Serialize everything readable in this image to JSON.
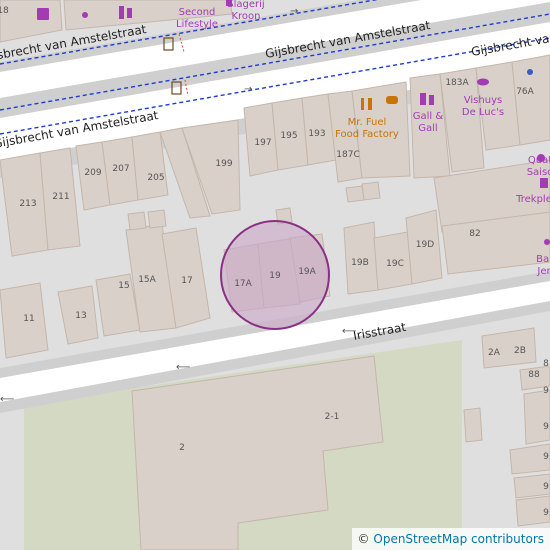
{
  "colors": {
    "background": "#e0dfdf",
    "building": "#d9d0c9",
    "building_stroke": "#c4b6ab",
    "road": "#ffffff",
    "road_casing": "#cfcfcf",
    "bike_route": "#1f3bd1",
    "landuse": "#d3d9c3",
    "poi_label": "#a33bb5",
    "poi_orange": "#c77400",
    "highlight_fill": "#c9a6c8",
    "highlight_stroke": "#8b2f86",
    "housenumber": "#555555",
    "street_label": "#222222"
  },
  "streets": [
    {
      "name": "Gijsbrecht van Amstelstraat"
    },
    {
      "name": "Gijsbrecht van Amstelstraat"
    },
    {
      "name": "Gijsbrecht van Amstelstraat"
    },
    {
      "name": "Gijsbrecht van Amstelstraat"
    },
    {
      "name": "Irisstraat"
    }
  ],
  "pois": [
    {
      "name": "Second Lifestyle",
      "lines": [
        "Second",
        "Lifestyle"
      ],
      "icon": "gift-shop-icon"
    },
    {
      "name": "Slagerij Kroon",
      "lines": [
        "Slagerij",
        "Kroon"
      ],
      "icon": "butcher-icon"
    },
    {
      "name": "Mr. Fuel Food Factory",
      "lines": [
        "Mr. Fuel",
        "Food Factory"
      ],
      "icon": "restaurant-icon"
    },
    {
      "name": "Gall & Gall",
      "lines": [
        "Gall &",
        "Gall"
      ],
      "icon": "liquor-store-icon"
    },
    {
      "name": "Vishuys De Luc's",
      "lines": [
        "Vishuys",
        "De Luc's"
      ],
      "icon": "fish-shop-icon"
    },
    {
      "name": "Quatre Saisons",
      "lines": [
        "Quat",
        "Saiso"
      ],
      "icon": "bakery-icon"
    },
    {
      "name": "Trekpleister",
      "lines": [
        "Trekple"
      ],
      "icon": "bicycle-shop-icon"
    },
    {
      "name": "Bakker Jerry",
      "lines": [
        "Bal",
        "Jer"
      ],
      "icon": "bakery-icon"
    }
  ],
  "housenumbers": [
    "18",
    "213",
    "211",
    "209",
    "207",
    "205",
    "199",
    "197",
    "195",
    "193",
    "187C",
    "183A",
    "76A",
    "11",
    "13",
    "15",
    "15A",
    "17",
    "17A",
    "19",
    "19A",
    "19B",
    "19C",
    "19D",
    "82",
    "2A",
    "2B",
    "88",
    "9",
    "2-1",
    "2",
    "8",
    "9",
    "9",
    "9",
    "9"
  ],
  "highlight": {
    "label": "Irisstraat 19"
  },
  "attribution": {
    "symbol": "©",
    "text": "OpenStreetMap contributors"
  }
}
